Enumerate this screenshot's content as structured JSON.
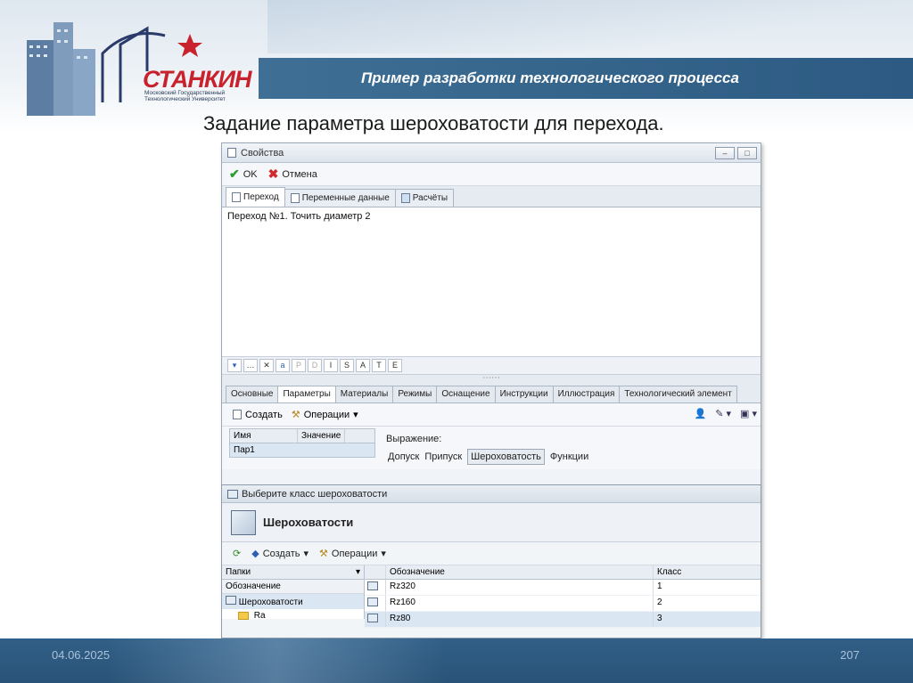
{
  "slide": {
    "title": "Пример разработки технологического процесса",
    "heading": "Задание параметра шероховатости для перехода.",
    "date": "04.06.2025",
    "page_number": "207",
    "logo_text": "СТАНКИН",
    "logo_subtitle": "Московский Государственный Технологический Университет"
  },
  "window": {
    "title": "Свойства",
    "ok_label": "OK",
    "cancel_label": "Отмена",
    "top_tabs": [
      "Переход",
      "Переменные данные",
      "Расчёты"
    ],
    "editor_text": "Переход №1. Точить диаметр 2",
    "format_buttons": [
      "P",
      "D",
      "I",
      "S",
      "A",
      "T",
      "E"
    ],
    "bottom_tabs": [
      "Основные",
      "Параметры",
      "Материалы",
      "Режимы",
      "Оснащение",
      "Инструкции",
      "Иллюстрация",
      "Технологический элемент"
    ],
    "create_label": "Создать",
    "operations_label": "Операции",
    "grid": {
      "col_name": "Имя",
      "col_value": "Значение",
      "rows": [
        "Пар1"
      ]
    },
    "expression_label": "Выражение:",
    "expression_tabs": [
      "Допуск",
      "Припуск",
      "Шероховатость",
      "Функции"
    ]
  },
  "dialog": {
    "title": "Выберите класс шероховатости",
    "header": "Шероховатости",
    "create_label": "Создать",
    "operations_label": "Операции",
    "folders_label": "Папки",
    "tree_column": "Обозначение",
    "tree_items": [
      "Шероховатости",
      "Ra"
    ],
    "table_headers": [
      "Обозначение",
      "Класс"
    ],
    "rows": [
      {
        "designation": "Rz320",
        "class": "1"
      },
      {
        "designation": "Rz160",
        "class": "2"
      },
      {
        "designation": "Rz80",
        "class": "3"
      }
    ]
  }
}
